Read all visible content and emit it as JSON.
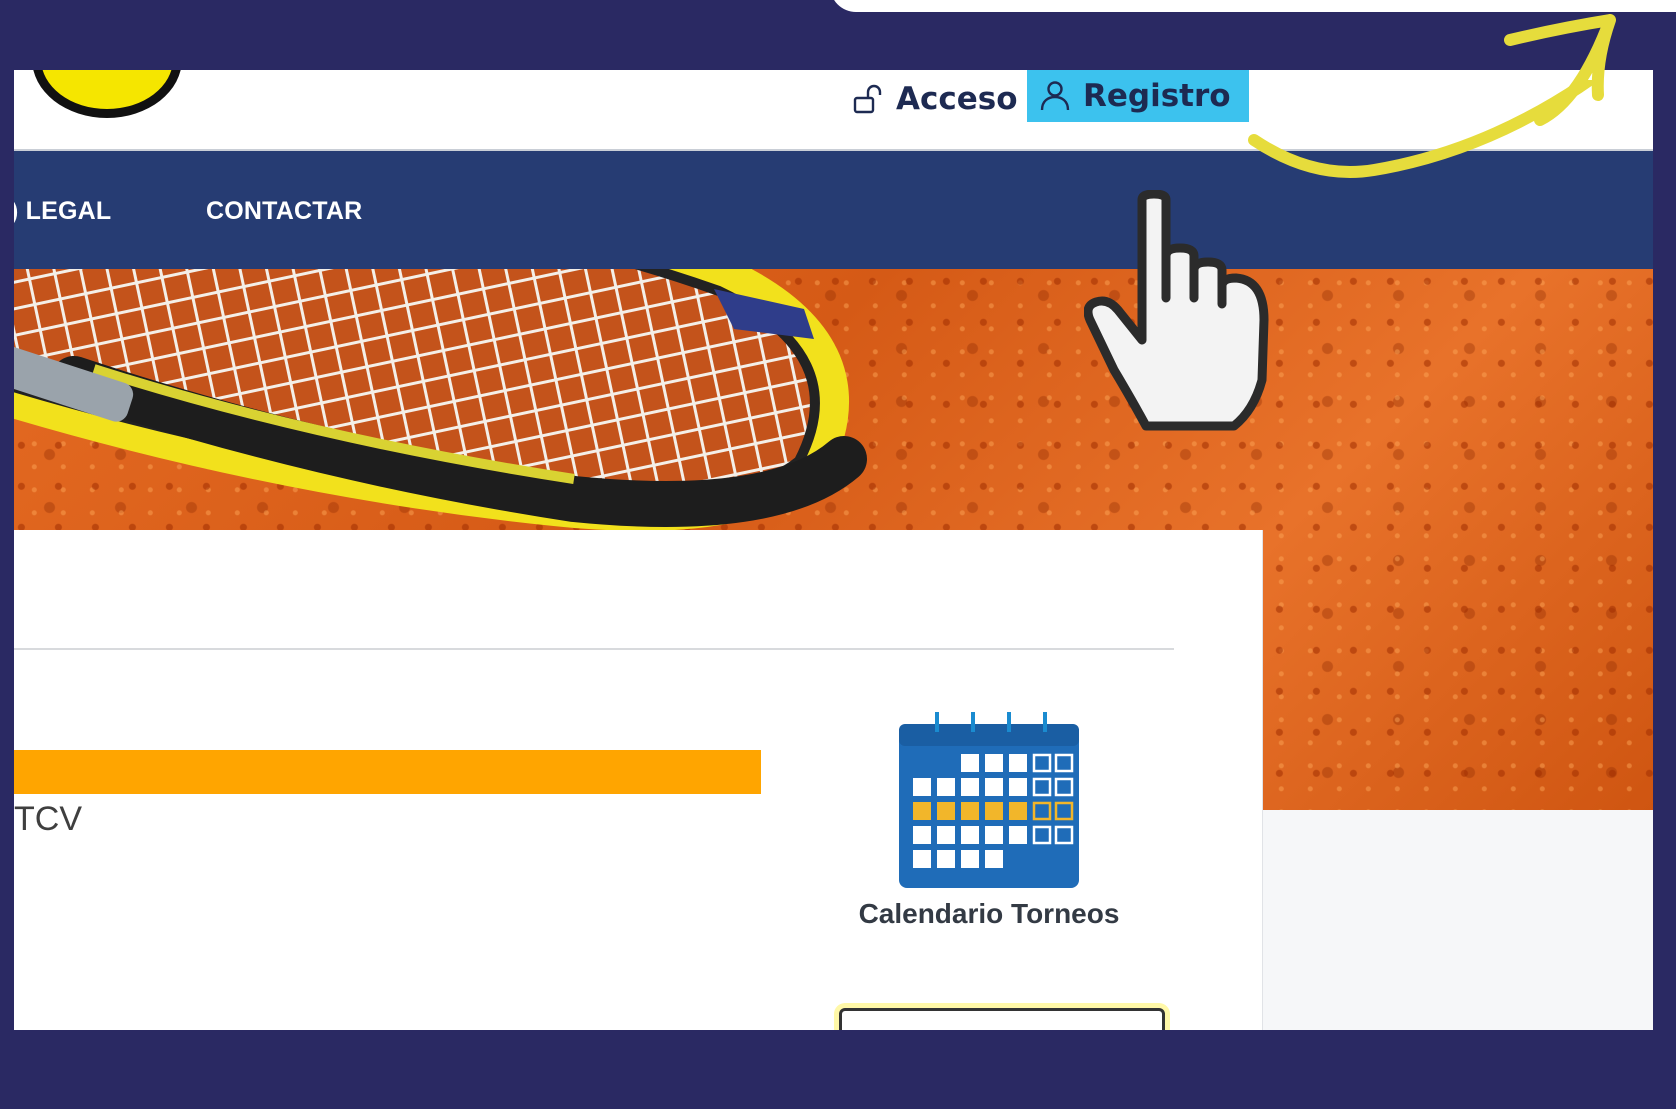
{
  "header": {
    "login_label": "Acceso",
    "register_label": "Registro"
  },
  "nav": {
    "items": [
      {
        "label": ") LEGAL"
      },
      {
        "label": "CONTACTAR"
      }
    ]
  },
  "content": {
    "partial_text": "TCV",
    "calendar_label": "Calendario Torneos"
  },
  "icons": {
    "login": "unlocked-padlock-icon",
    "register": "user-icon",
    "pointer": "pointing-hand-icon",
    "arrow": "curved-arrow-icon",
    "calendar": "calendar-icon"
  },
  "colors": {
    "background": "#2a2963",
    "nav_bar": "#263c73",
    "register_highlight": "#3cc2ee",
    "accent_bar": "#ffa500",
    "arrow": "#e6dc3c"
  }
}
